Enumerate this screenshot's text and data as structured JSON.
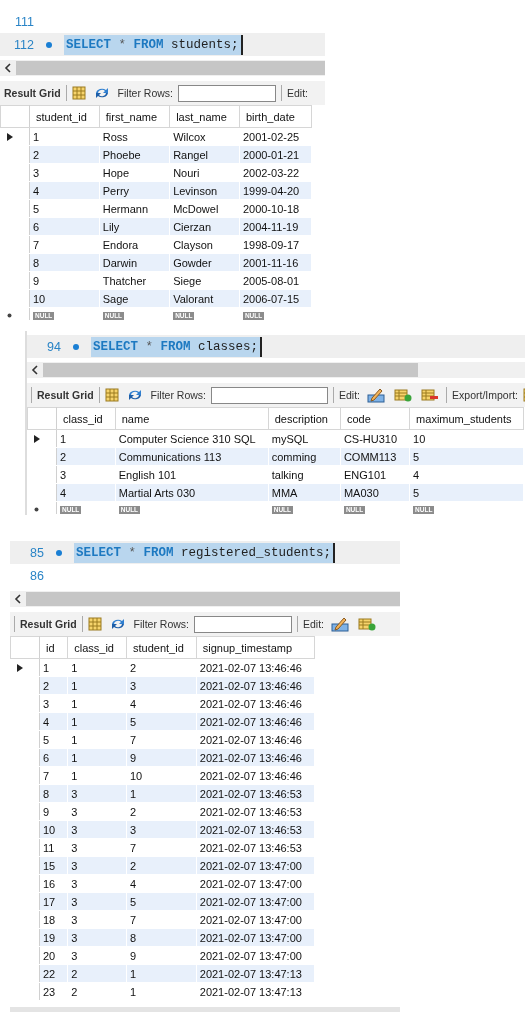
{
  "panels": [
    {
      "editor": [
        {
          "number": "111",
          "dot": false,
          "current": false
        },
        {
          "number": "112",
          "dot": true,
          "current": true,
          "tokens": [
            {
              "text": "SELECT",
              "kind": "keyword"
            },
            {
              "text": " * ",
              "kind": "operator"
            },
            {
              "text": "FROM",
              "kind": "keyword"
            },
            {
              "text": " students;",
              "kind": "identifier"
            }
          ]
        }
      ],
      "toolbar": [
        {
          "kind": "label",
          "text": "Result Grid"
        },
        {
          "kind": "separator"
        },
        {
          "kind": "grid-icon"
        },
        {
          "kind": "refresh-icon"
        },
        {
          "kind": "filter",
          "text": "Filter Rows:"
        },
        {
          "kind": "separator"
        },
        {
          "kind": "label",
          "text": "Edit:"
        }
      ],
      "columns": [
        "student_id",
        "first_name",
        "last_name",
        "birth_date"
      ],
      "rows": [
        {
          "selected": true,
          "cells": [
            "1",
            "Ross",
            "Wilcox",
            "2001-02-25"
          ]
        },
        {
          "selected": false,
          "cells": [
            "2",
            "Phoebe",
            "Rangel",
            "2000-01-21"
          ]
        },
        {
          "selected": false,
          "cells": [
            "3",
            "Hope",
            "Nouri",
            "2002-03-22"
          ]
        },
        {
          "selected": false,
          "cells": [
            "4",
            "Perry",
            "Levinson",
            "1999-04-20"
          ]
        },
        {
          "selected": false,
          "cells": [
            "5",
            "Hermann",
            "McDowel",
            "2000-10-18"
          ]
        },
        {
          "selected": false,
          "cells": [
            "6",
            "Lily",
            "Cierzan",
            "2004-11-19"
          ]
        },
        {
          "selected": false,
          "cells": [
            "7",
            "Endora",
            "Clayson",
            "1998-09-17"
          ]
        },
        {
          "selected": false,
          "cells": [
            "8",
            "Darwin",
            "Gowder",
            "2001-11-16"
          ]
        },
        {
          "selected": false,
          "cells": [
            "9",
            "Thatcher",
            "Siege",
            "2005-08-01"
          ]
        },
        {
          "selected": false,
          "cells": [
            "10",
            "Sage",
            "Valorant",
            "2006-07-15"
          ]
        }
      ],
      "null_row": [
        "NULL",
        "NULL",
        "NULL",
        "NULL"
      ]
    },
    {
      "editor": [
        {
          "number": "94",
          "dot": true,
          "current": true,
          "tokens": [
            {
              "text": "SELECT",
              "kind": "keyword"
            },
            {
              "text": " * ",
              "kind": "operator"
            },
            {
              "text": "FROM",
              "kind": "keyword"
            },
            {
              "text": " classes;",
              "kind": "identifier"
            }
          ]
        }
      ],
      "toolbar": [
        {
          "kind": "separator"
        },
        {
          "kind": "label",
          "text": "Result Grid"
        },
        {
          "kind": "separator"
        },
        {
          "kind": "grid-icon"
        },
        {
          "kind": "refresh-icon"
        },
        {
          "kind": "filter",
          "text": "Filter Rows:"
        },
        {
          "kind": "separator"
        },
        {
          "kind": "label",
          "text": "Edit:"
        },
        {
          "kind": "pencil-icon"
        },
        {
          "kind": "add-row-icon"
        },
        {
          "kind": "delete-row-icon"
        },
        {
          "kind": "separator"
        },
        {
          "kind": "label",
          "text": "Export/Import:"
        },
        {
          "kind": "grid-icon"
        }
      ],
      "columns": [
        "class_id",
        "name",
        "description",
        "code",
        "maximum_students"
      ],
      "rows": [
        {
          "selected": true,
          "cells": [
            "1",
            "Computer Science 310 SQL",
            "mySQL",
            "CS-HU310",
            "10"
          ]
        },
        {
          "selected": false,
          "cells": [
            "2",
            "Communications 113",
            "comming",
            "COMM113",
            "5"
          ]
        },
        {
          "selected": false,
          "cells": [
            "3",
            "English 101",
            "talking",
            "ENG101",
            "4"
          ]
        },
        {
          "selected": false,
          "cells": [
            "4",
            "Martial Arts 030",
            "MMA",
            "MA030",
            "5"
          ]
        }
      ],
      "null_row": [
        "NULL",
        "NULL",
        "NULL",
        "NULL",
        "NULL"
      ]
    },
    {
      "editor": [
        {
          "number": "85",
          "dot": true,
          "current": true,
          "tokens": [
            {
              "text": "SELECT",
              "kind": "keyword"
            },
            {
              "text": " * ",
              "kind": "operator"
            },
            {
              "text": "FROM",
              "kind": "keyword"
            },
            {
              "text": " registered_students;",
              "kind": "identifier"
            }
          ]
        },
        {
          "number": "86",
          "dot": false,
          "current": false
        }
      ],
      "toolbar": [
        {
          "kind": "separator"
        },
        {
          "kind": "label",
          "text": "Result Grid"
        },
        {
          "kind": "separator"
        },
        {
          "kind": "grid-icon"
        },
        {
          "kind": "refresh-icon"
        },
        {
          "kind": "filter",
          "text": "Filter Rows:"
        },
        {
          "kind": "separator"
        },
        {
          "kind": "label",
          "text": "Edit:"
        },
        {
          "kind": "pencil-icon"
        },
        {
          "kind": "add-row-icon"
        }
      ],
      "columns": [
        "id",
        "class_id",
        "student_id",
        "signup_timestamp"
      ],
      "rows": [
        {
          "selected": true,
          "cells": [
            "1",
            "1",
            "2",
            "2021-02-07 13:46:46"
          ]
        },
        {
          "selected": false,
          "cells": [
            "2",
            "1",
            "3",
            "2021-02-07 13:46:46"
          ]
        },
        {
          "selected": false,
          "cells": [
            "3",
            "1",
            "4",
            "2021-02-07 13:46:46"
          ]
        },
        {
          "selected": false,
          "cells": [
            "4",
            "1",
            "5",
            "2021-02-07 13:46:46"
          ]
        },
        {
          "selected": false,
          "cells": [
            "5",
            "1",
            "7",
            "2021-02-07 13:46:46"
          ]
        },
        {
          "selected": false,
          "cells": [
            "6",
            "1",
            "9",
            "2021-02-07 13:46:46"
          ]
        },
        {
          "selected": false,
          "cells": [
            "7",
            "1",
            "10",
            "2021-02-07 13:46:46"
          ]
        },
        {
          "selected": false,
          "cells": [
            "8",
            "3",
            "1",
            "2021-02-07 13:46:53"
          ]
        },
        {
          "selected": false,
          "cells": [
            "9",
            "3",
            "2",
            "2021-02-07 13:46:53"
          ]
        },
        {
          "selected": false,
          "cells": [
            "10",
            "3",
            "3",
            "2021-02-07 13:46:53"
          ]
        },
        {
          "selected": false,
          "cells": [
            "11",
            "3",
            "7",
            "2021-02-07 13:46:53"
          ]
        },
        {
          "selected": false,
          "cells": [
            "15",
            "3",
            "2",
            "2021-02-07 13:47:00"
          ]
        },
        {
          "selected": false,
          "cells": [
            "16",
            "3",
            "4",
            "2021-02-07 13:47:00"
          ]
        },
        {
          "selected": false,
          "cells": [
            "17",
            "3",
            "5",
            "2021-02-07 13:47:00"
          ]
        },
        {
          "selected": false,
          "cells": [
            "18",
            "3",
            "7",
            "2021-02-07 13:47:00"
          ]
        },
        {
          "selected": false,
          "cells": [
            "19",
            "3",
            "8",
            "2021-02-07 13:47:00"
          ]
        },
        {
          "selected": false,
          "cells": [
            "20",
            "3",
            "9",
            "2021-02-07 13:47:00"
          ]
        },
        {
          "selected": false,
          "cells": [
            "22",
            "2",
            "1",
            "2021-02-07 13:47:13"
          ]
        },
        {
          "selected": false,
          "cells": [
            "23",
            "2",
            "1",
            "2021-02-07 13:47:13"
          ]
        }
      ]
    }
  ]
}
